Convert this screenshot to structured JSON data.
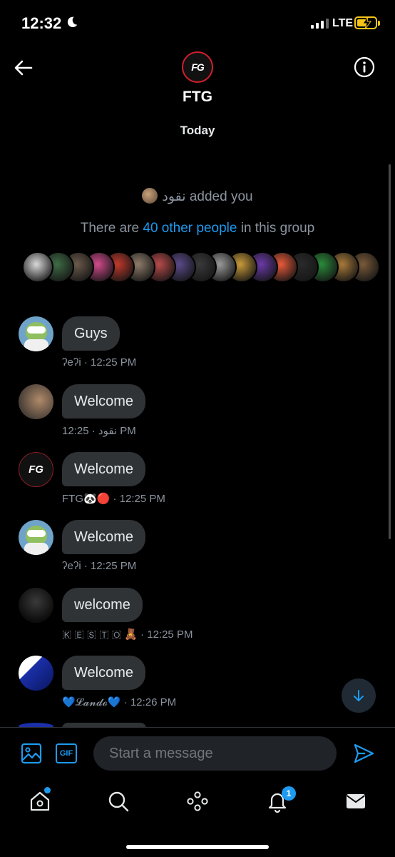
{
  "status_bar": {
    "time": "12:32",
    "network": "LTE"
  },
  "header": {
    "group_name": "FTG",
    "avatar_logo": "FG",
    "date_label": "Today"
  },
  "system": {
    "added_text": "نقود added you",
    "others_prefix": "There are ",
    "others_link": "40 other people",
    "others_suffix": " in this group"
  },
  "member_strip": {
    "count": 17,
    "colors": [
      "#d9d9d9",
      "#3f6b45",
      "#6b5a4a",
      "#d24b8c",
      "#c0392b",
      "#8e7c6a",
      "#b84a4a",
      "#5a4a8a",
      "#3a3a3a",
      "#9a9a9a",
      "#c89a3a",
      "#6a3aa8",
      "#e85a3a",
      "#2a2a2a",
      "#2a8a3a",
      "#a87a3a",
      "#7a5a3a"
    ]
  },
  "messages": [
    {
      "text": "Guys",
      "sender": "ʔeʔi",
      "time": "12:25 PM",
      "avatar": "alien"
    },
    {
      "text": "Welcome",
      "sender": "نقود",
      "time": "12:25 PM",
      "avatar": "hand"
    },
    {
      "text": "Welcome",
      "sender": "FTG🐼🔴",
      "time": "12:25 PM",
      "avatar": "ftg",
      "avatar_logo": "FG"
    },
    {
      "text": "Welcome",
      "sender": "ʔeʔi",
      "time": "12:25 PM",
      "avatar": "alien"
    },
    {
      "text": "welcome",
      "sender": "🇰 🇪 🇸 🇹 🇴 🧸",
      "time": "12:25 PM",
      "avatar": "hood"
    },
    {
      "text": "Welcome",
      "sender": "💙𝓛𝓪𝓷𝓭𝓸💙",
      "time": "12:26 PM",
      "avatar": "lando"
    }
  ],
  "meta_separator": " · ",
  "composer": {
    "placeholder": "Start a message",
    "gif_label": "GIF"
  },
  "tabbar": {
    "items": [
      "home-icon",
      "search-icon",
      "spaces-icon",
      "notifications-icon",
      "messages-icon"
    ],
    "notification_count": "1"
  },
  "colors": {
    "accent": "#1d9bf0",
    "bubble": "#2f3336",
    "muted": "#8b949e",
    "ftg_red": "#d21f2b"
  }
}
